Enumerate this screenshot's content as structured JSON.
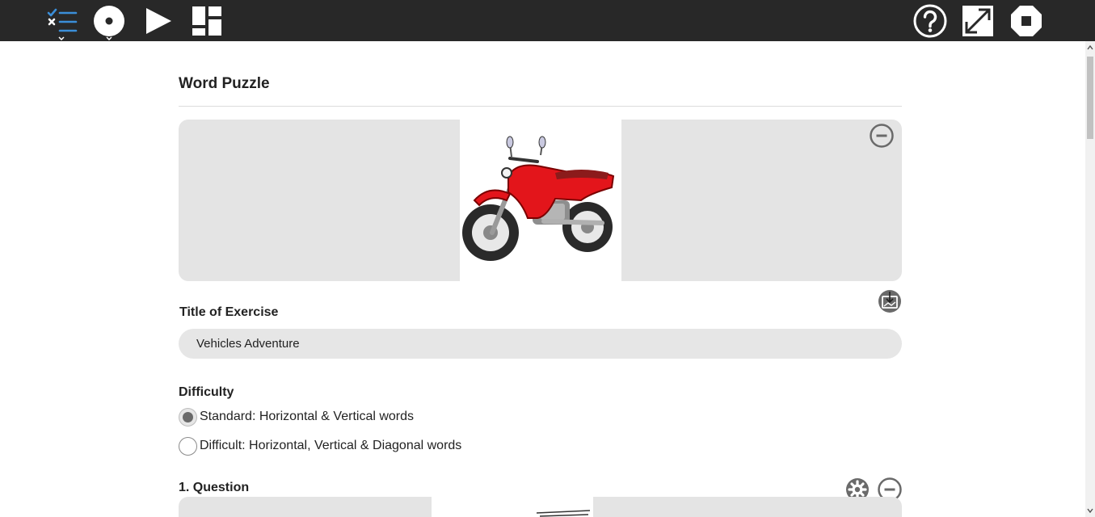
{
  "toolbar": {
    "icons": [
      "tasks-list-icon",
      "record-icon",
      "play-icon",
      "layout-grid-icon",
      "help-icon",
      "fullscreen-icon",
      "stop-icon"
    ]
  },
  "page": {
    "title": "Word Puzzle"
  },
  "exercise": {
    "title_label": "Title of Exercise",
    "title_value": "Vehicles Adventure",
    "image": "motorcycle-illustration"
  },
  "difficulty": {
    "label": "Difficulty",
    "options": [
      {
        "label": "Standard: Horizontal & Vertical words",
        "checked": true
      },
      {
        "label": "Difficult: Horizontal, Vertical & Diagonal words",
        "checked": false
      }
    ]
  },
  "questions": [
    {
      "label": "1. Question"
    }
  ],
  "colors": {
    "toolbar_bg": "#282828",
    "accent_blue": "#3b8ed8",
    "panel_bg": "#e4e4e4",
    "icon_gray": "#6a6a6a"
  }
}
